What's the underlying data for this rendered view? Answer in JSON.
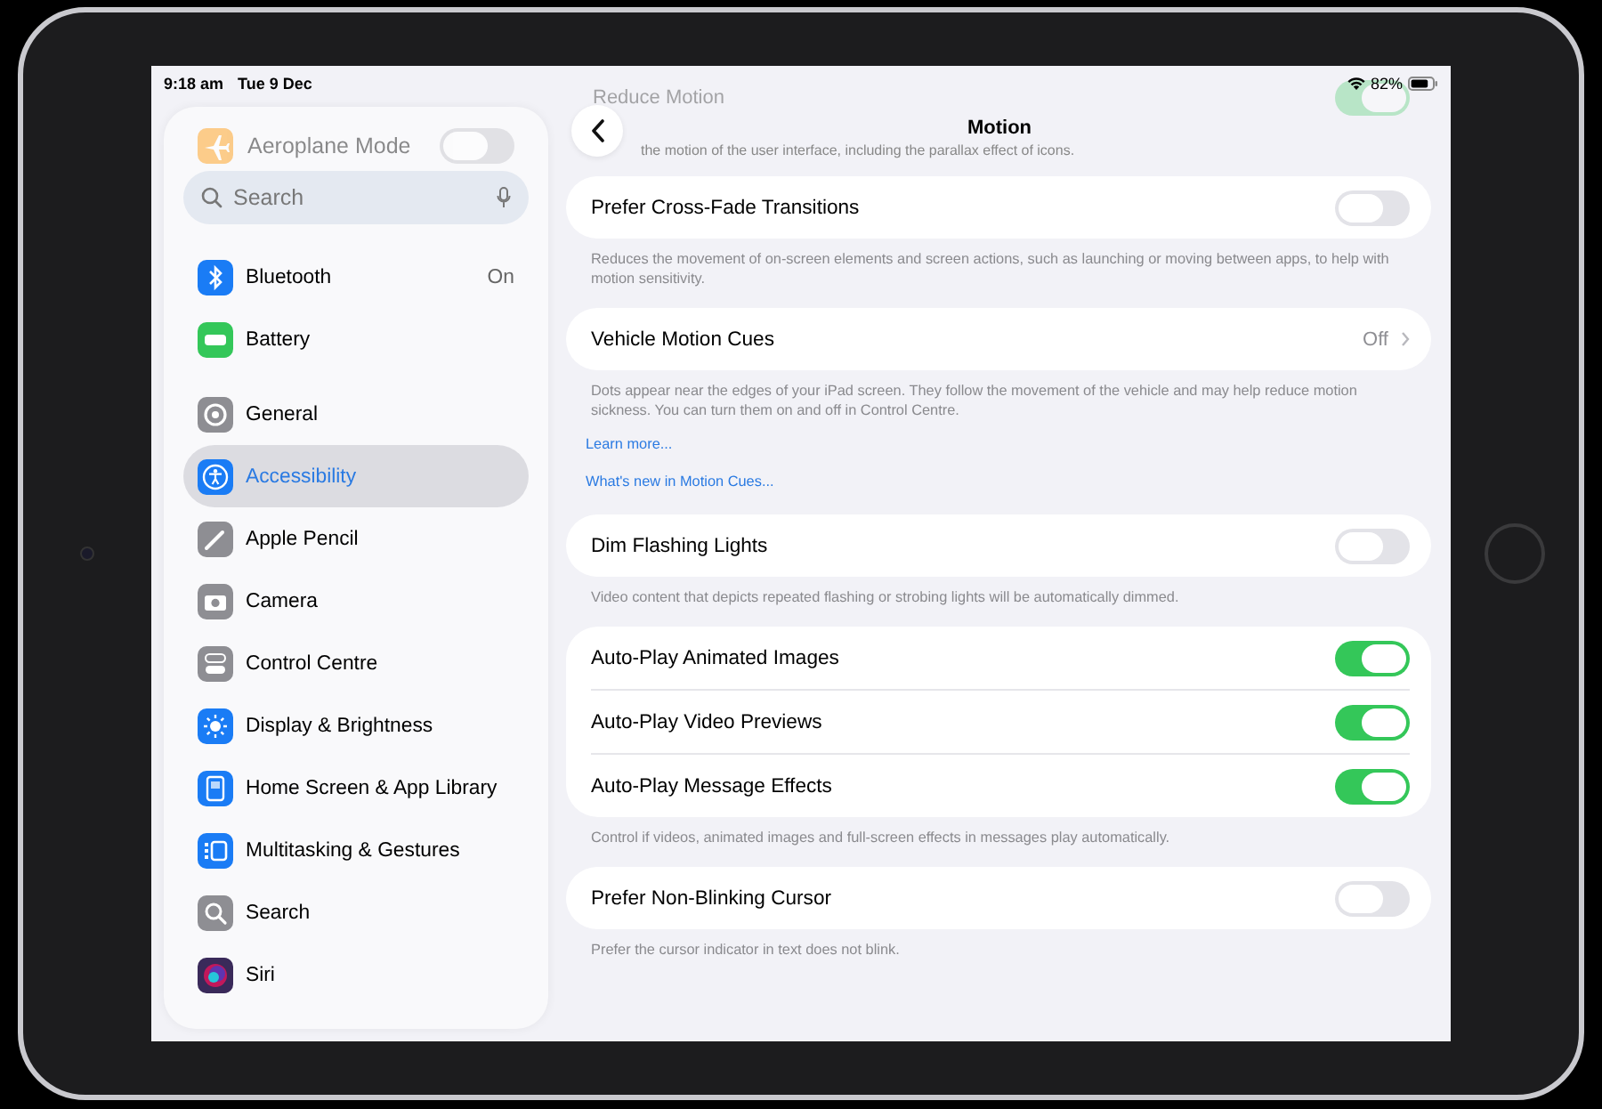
{
  "status_bar": {
    "time": "9:18 am",
    "date": "Tue 9 Dec",
    "battery": "82%"
  },
  "sidebar": {
    "faded_item": {
      "label": "Aeroplane Mode",
      "on": false
    },
    "search": {
      "placeholder": "Search"
    },
    "groups": [
      [
        {
          "label": "Bluetooth",
          "value": "On",
          "selected": false
        },
        {
          "label": "Battery",
          "selected": false
        }
      ],
      [
        {
          "label": "General",
          "selected": false
        },
        {
          "label": "Accessibility",
          "selected": true
        },
        {
          "label": "Apple Pencil",
          "selected": false
        },
        {
          "label": "Camera",
          "selected": false
        },
        {
          "label": "Control Centre",
          "selected": false
        },
        {
          "label": "Display & Brightness",
          "selected": false
        },
        {
          "label": "Home Screen & App Library",
          "selected": false
        },
        {
          "label": "Multitasking & Gestures",
          "selected": false
        },
        {
          "label": "Search",
          "selected": false
        },
        {
          "label": "Siri",
          "selected": false
        }
      ]
    ]
  },
  "detail": {
    "title": "Motion",
    "faded_row": {
      "label": "Reduce Motion",
      "on": true,
      "description": "the motion of the user interface, including the parallax effect of icons."
    },
    "sections": [
      {
        "rows": [
          {
            "kind": "toggle",
            "label": "Prefer Cross-Fade Transitions",
            "on": false
          }
        ],
        "footer": "Reduces the movement of on-screen elements and screen actions, such as launching or moving between apps, to help with motion sensitivity."
      },
      {
        "rows": [
          {
            "kind": "link",
            "label": "Vehicle Motion Cues",
            "value": "Off"
          }
        ],
        "footer": "Dots appear near the edges of your iPad screen. They follow the movement of the vehicle and may help reduce motion sickness. You can turn them on and off in Control Centre.",
        "links": [
          "Learn more...",
          "What's new in Motion Cues..."
        ]
      },
      {
        "rows": [
          {
            "kind": "toggle",
            "label": "Dim Flashing Lights",
            "on": false
          }
        ],
        "footer": "Video content that depicts repeated flashing or strobing lights will be automatically dimmed."
      },
      {
        "rows": [
          {
            "kind": "toggle",
            "label": "Auto-Play Animated Images",
            "on": true
          },
          {
            "kind": "toggle",
            "label": "Auto-Play Video Previews",
            "on": true
          },
          {
            "kind": "toggle",
            "label": "Auto-Play Message Effects",
            "on": true
          }
        ],
        "footer": "Control if videos, animated images and full-screen effects in messages play automatically."
      },
      {
        "rows": [
          {
            "kind": "toggle",
            "label": "Prefer Non-Blinking Cursor",
            "on": false
          }
        ],
        "footer": "Prefer the cursor indicator in text does not blink."
      }
    ]
  }
}
